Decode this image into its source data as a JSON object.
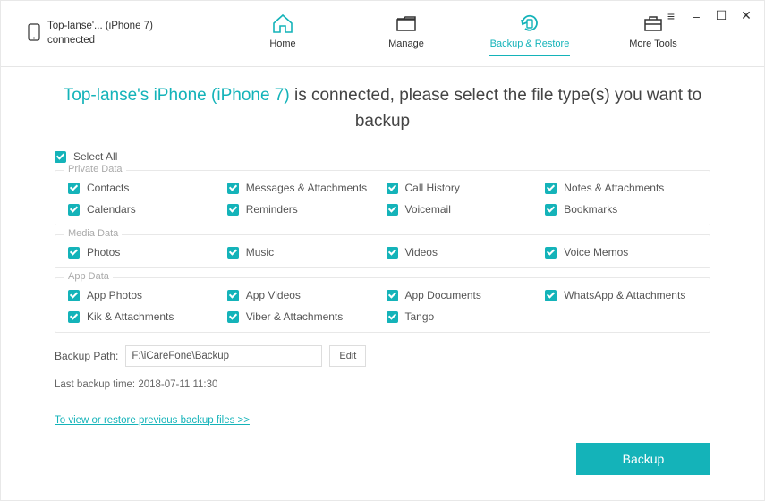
{
  "window": {
    "menu": "≡",
    "min": "–",
    "max": "☐",
    "close": "✕"
  },
  "device": {
    "name": "Top-lanse'... (iPhone 7)",
    "status": "connected"
  },
  "nav": {
    "home": "Home",
    "manage": "Manage",
    "backup": "Backup & Restore",
    "tools": "More Tools"
  },
  "headline": {
    "device_name": "Top-lanse's iPhone (iPhone 7)",
    "rest": " is connected, please select the file type(s) you want to backup"
  },
  "select_all": "Select All",
  "groups": {
    "private": {
      "title": "Private Data",
      "items": [
        "Contacts",
        "Messages & Attachments",
        "Call History",
        "Notes & Attachments",
        "Calendars",
        "Reminders",
        "Voicemail",
        "Bookmarks"
      ]
    },
    "media": {
      "title": "Media Data",
      "items": [
        "Photos",
        "Music",
        "Videos",
        "Voice Memos"
      ]
    },
    "app": {
      "title": "App Data",
      "items": [
        "App Photos",
        "App Videos",
        "App Documents",
        "WhatsApp & Attachments",
        "Kik & Attachments",
        "Viber & Attachments",
        "Tango"
      ]
    }
  },
  "backup_path_label": "Backup Path:",
  "backup_path_value": "F:\\iCareFone\\Backup",
  "edit_label": "Edit",
  "last_backup": "Last backup time: 2018-07-11 11:30",
  "link": "To view or restore previous backup files >>",
  "backup_btn": "Backup"
}
